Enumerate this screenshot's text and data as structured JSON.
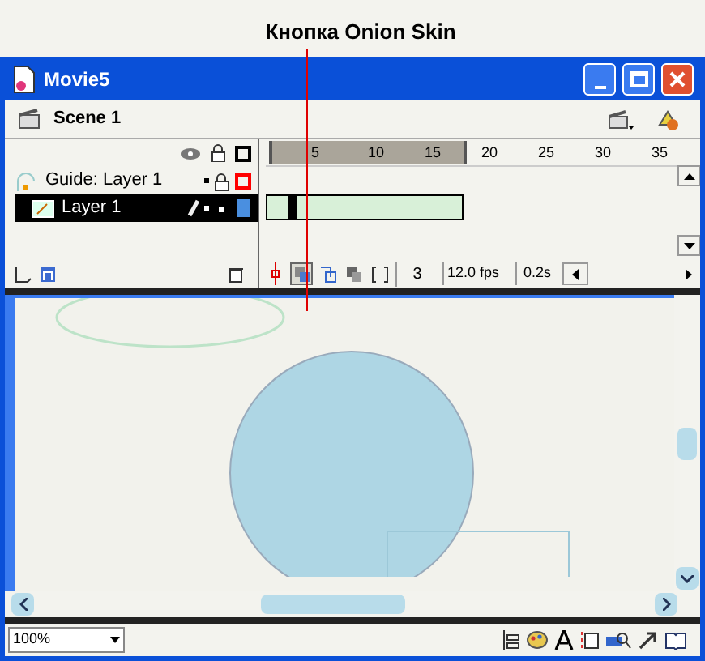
{
  "callout": {
    "label": "Кнопка Onion Skin"
  },
  "window": {
    "title": "Movie5"
  },
  "scene": {
    "name": "Scene 1"
  },
  "timeline": {
    "ruler": [
      "5",
      "10",
      "15",
      "20",
      "25",
      "30",
      "35"
    ],
    "layers": [
      {
        "name": "Guide: Layer 1",
        "kind": "guide",
        "selected": false,
        "color": "#ff0000"
      },
      {
        "name": "Layer 1",
        "kind": "normal",
        "selected": true,
        "color": "#4a8fe0"
      }
    ],
    "onion_buttons": [
      {
        "selected": true
      },
      {
        "selected": false
      },
      {
        "selected": false
      },
      {
        "selected": false
      }
    ],
    "current_frame": "3",
    "frame_rate": "12.0 fps",
    "elapsed": "0.2s"
  },
  "zoom": {
    "value": "100%"
  }
}
